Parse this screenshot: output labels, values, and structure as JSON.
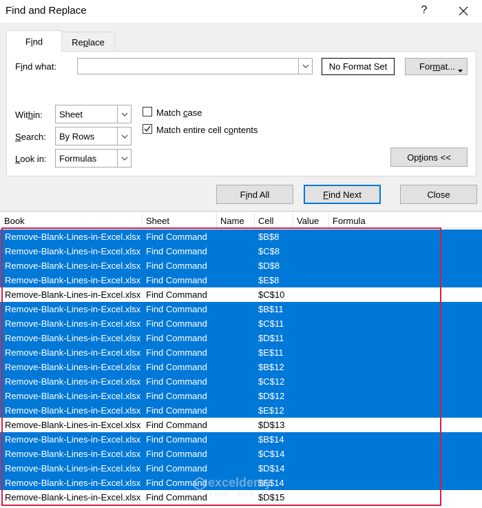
{
  "window": {
    "title": "Find and Replace",
    "help": "?"
  },
  "tabs": [
    {
      "label": "Find",
      "underline": "i",
      "active": true
    },
    {
      "label": "Replace",
      "underline": "p",
      "active": false
    }
  ],
  "find": {
    "label": "Find what:",
    "value": "",
    "no_format": "No Format Set",
    "format_button": "Format..."
  },
  "options": {
    "within_label": "Within:",
    "within_value": "Sheet",
    "search_label": "Search:",
    "search_value": "By Rows",
    "lookin_label": "Look in:",
    "lookin_value": "Formulas",
    "match_case_label": "Match case",
    "match_case_checked": false,
    "match_entire_label": "Match entire cell contents",
    "match_entire_checked": true,
    "options_button": "Options <<"
  },
  "buttons": {
    "find_all": "Find All",
    "find_next": "Find Next",
    "close": "Close"
  },
  "results": {
    "columns": [
      "Book",
      "Sheet",
      "Name",
      "Cell",
      "Value",
      "Formula"
    ],
    "rows": [
      {
        "book": "Remove-Blank-Lines-in-Excel.xlsx",
        "sheet": "Find Command",
        "cell": "$B$8",
        "selected": true
      },
      {
        "book": "Remove-Blank-Lines-in-Excel.xlsx",
        "sheet": "Find Command",
        "cell": "$C$8",
        "selected": true
      },
      {
        "book": "Remove-Blank-Lines-in-Excel.xlsx",
        "sheet": "Find Command",
        "cell": "$D$8",
        "selected": true
      },
      {
        "book": "Remove-Blank-Lines-in-Excel.xlsx",
        "sheet": "Find Command",
        "cell": "$E$8",
        "selected": true
      },
      {
        "book": "Remove-Blank-Lines-in-Excel.xlsx",
        "sheet": "Find Command",
        "cell": "$C$10",
        "selected": false
      },
      {
        "book": "Remove-Blank-Lines-in-Excel.xlsx",
        "sheet": "Find Command",
        "cell": "$B$11",
        "selected": true
      },
      {
        "book": "Remove-Blank-Lines-in-Excel.xlsx",
        "sheet": "Find Command",
        "cell": "$C$11",
        "selected": true
      },
      {
        "book": "Remove-Blank-Lines-in-Excel.xlsx",
        "sheet": "Find Command",
        "cell": "$D$11",
        "selected": true
      },
      {
        "book": "Remove-Blank-Lines-in-Excel.xlsx",
        "sheet": "Find Command",
        "cell": "$E$11",
        "selected": true
      },
      {
        "book": "Remove-Blank-Lines-in-Excel.xlsx",
        "sheet": "Find Command",
        "cell": "$B$12",
        "selected": true
      },
      {
        "book": "Remove-Blank-Lines-in-Excel.xlsx",
        "sheet": "Find Command",
        "cell": "$C$12",
        "selected": true
      },
      {
        "book": "Remove-Blank-Lines-in-Excel.xlsx",
        "sheet": "Find Command",
        "cell": "$D$12",
        "selected": true
      },
      {
        "book": "Remove-Blank-Lines-in-Excel.xlsx",
        "sheet": "Find Command",
        "cell": "$E$12",
        "selected": true
      },
      {
        "book": "Remove-Blank-Lines-in-Excel.xlsx",
        "sheet": "Find Command",
        "cell": "$D$13",
        "selected": false
      },
      {
        "book": "Remove-Blank-Lines-in-Excel.xlsx",
        "sheet": "Find Command",
        "cell": "$B$14",
        "selected": true
      },
      {
        "book": "Remove-Blank-Lines-in-Excel.xlsx",
        "sheet": "Find Command",
        "cell": "$C$14",
        "selected": true
      },
      {
        "book": "Remove-Blank-Lines-in-Excel.xlsx",
        "sheet": "Find Command",
        "cell": "$D$14",
        "selected": true
      },
      {
        "book": "Remove-Blank-Lines-in-Excel.xlsx",
        "sheet": "Find Command",
        "cell": "$E$14",
        "selected": true
      },
      {
        "book": "Remove-Blank-Lines-in-Excel.xlsx",
        "sheet": "Find Command",
        "cell": "$D$15",
        "selected": false
      }
    ]
  },
  "watermark": {
    "text": "exceldemy",
    "subtext": "EXCEL · DATA · BI"
  },
  "colors": {
    "selection": "#0078d7",
    "highlight_box": "#d6203a",
    "dialog_bg": "#f0f0f0"
  }
}
